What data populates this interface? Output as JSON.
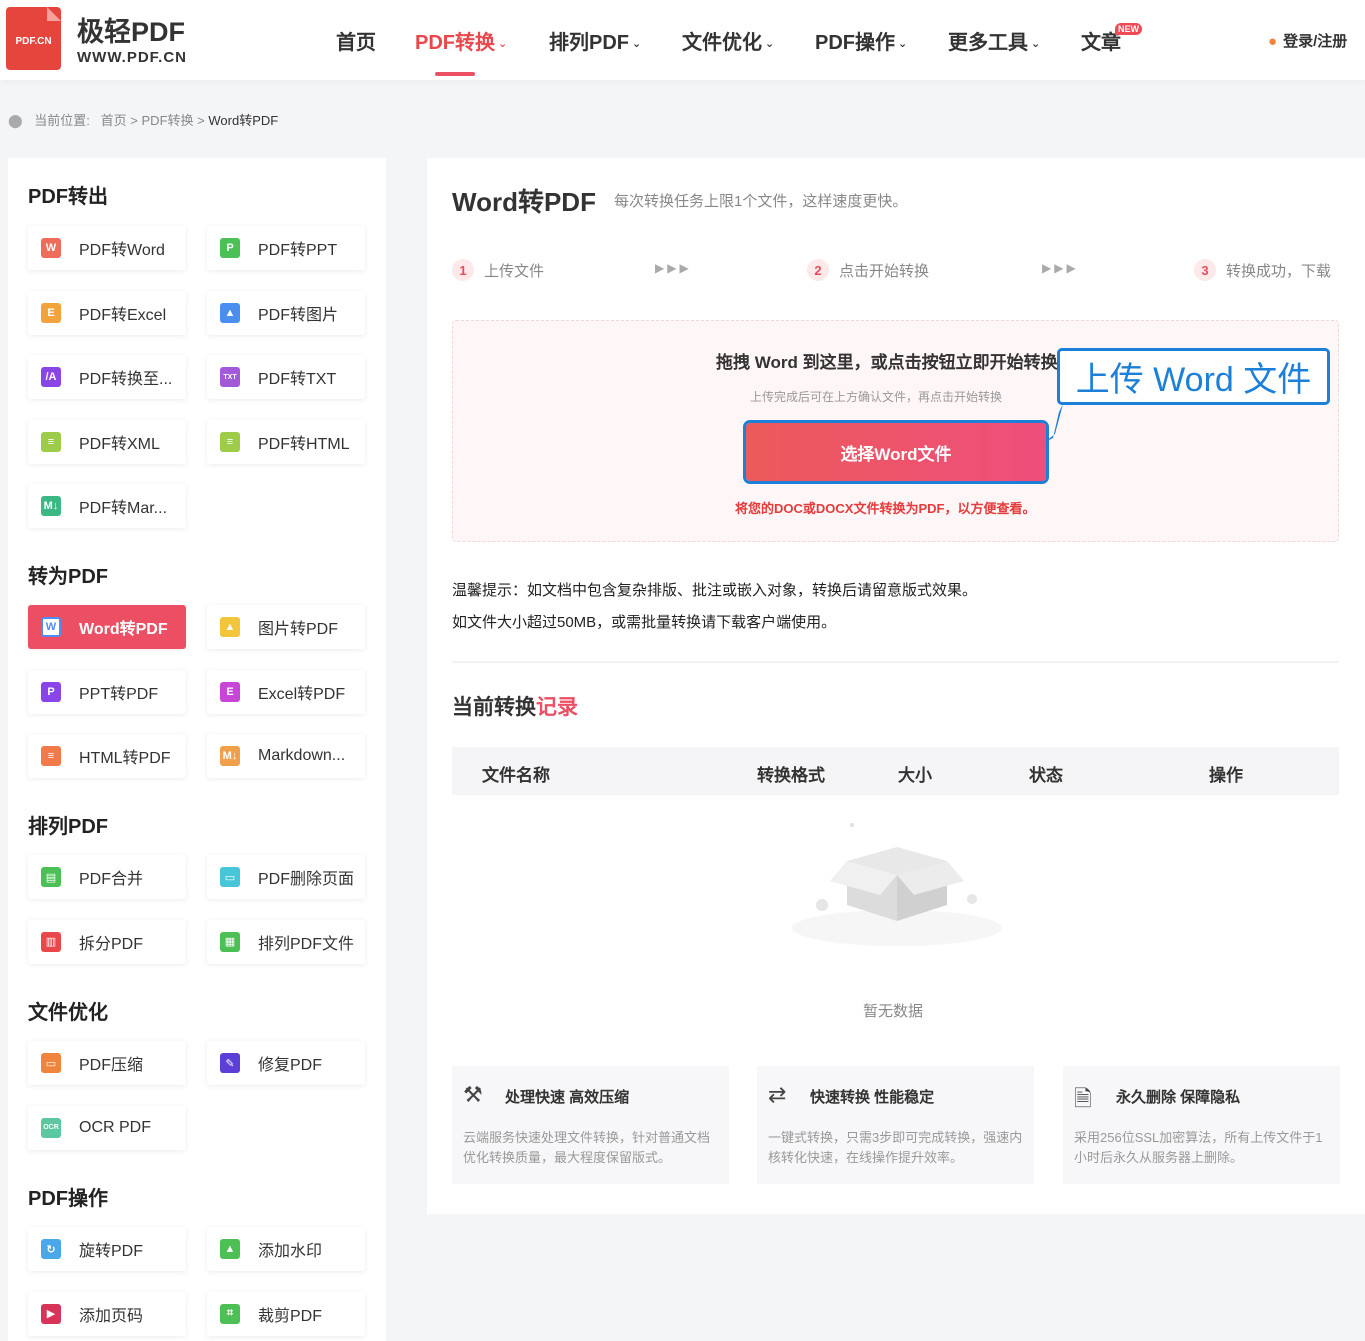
{
  "header": {
    "logo_text": "PDF.CN",
    "brand_name": "极轻PDF",
    "brand_url": "WWW.PDF.CN",
    "nav": [
      {
        "label": "首页",
        "chevron": false,
        "active": false
      },
      {
        "label": "PDF转换",
        "chevron": true,
        "active": true
      },
      {
        "label": "排列PDF",
        "chevron": true,
        "active": false
      },
      {
        "label": "文件优化",
        "chevron": true,
        "active": false
      },
      {
        "label": "PDF操作",
        "chevron": true,
        "active": false
      },
      {
        "label": "更多工具",
        "chevron": true,
        "active": false
      },
      {
        "label": "文章",
        "chevron": false,
        "active": false
      }
    ],
    "new_badge": "NEW",
    "login": "登录/注册"
  },
  "breadcrumb": {
    "prefix": "当前位置:",
    "home": "首页",
    "sep1": ">",
    "section": "PDF转换",
    "sep2": ">",
    "current": "Word转PDF"
  },
  "sidebar": {
    "sections": [
      {
        "title": "PDF转出",
        "items": [
          {
            "label": "PDF转Word",
            "icon": "word-icon",
            "glyph": "W",
            "color": "#ef6b5a"
          },
          {
            "label": "PDF转PPT",
            "icon": "ppt-icon",
            "glyph": "P",
            "color": "#4cbf55"
          },
          {
            "label": "PDF转Excel",
            "icon": "excel-icon",
            "glyph": "E",
            "color": "#f4a23b"
          },
          {
            "label": "PDF转图片",
            "icon": "image-icon",
            "glyph": "▲",
            "color": "#4a8ff0"
          },
          {
            "label": "PDF转换至...",
            "icon": "convert-icon",
            "glyph": "/A",
            "color": "#8a45e8"
          },
          {
            "label": "PDF转TXT",
            "icon": "txt-icon",
            "glyph": "TXT",
            "color": "#a35ad8"
          },
          {
            "label": "PDF转XML",
            "icon": "xml-icon",
            "glyph": "≡",
            "color": "#9ccc48"
          },
          {
            "label": "PDF转HTML",
            "icon": "html-icon",
            "glyph": "≡",
            "color": "#9ccc48"
          },
          {
            "label": "PDF转Mar...",
            "icon": "markdown-icon",
            "glyph": "M↓",
            "color": "#3bb884"
          }
        ]
      },
      {
        "title": "转为PDF",
        "items": [
          {
            "label": "Word转PDF",
            "icon": "word-icon",
            "glyph": "W",
            "color": "#4f8df5",
            "active": true
          },
          {
            "label": "图片转PDF",
            "icon": "image-icon",
            "glyph": "▲",
            "color": "#f2c53b"
          },
          {
            "label": "PPT转PDF",
            "icon": "ppt-icon",
            "glyph": "P",
            "color": "#8a45e8"
          },
          {
            "label": "Excel转PDF",
            "icon": "excel-icon",
            "glyph": "E",
            "color": "#c846d6"
          },
          {
            "label": "HTML转PDF",
            "icon": "html-icon",
            "glyph": "≡",
            "color": "#f07a4a"
          },
          {
            "label": "Markdown...",
            "icon": "markdown-icon",
            "glyph": "M↓",
            "color": "#f0a04a"
          }
        ]
      },
      {
        "title": "排列PDF",
        "items": [
          {
            "label": "PDF合并",
            "icon": "merge-icon",
            "glyph": "▤",
            "color": "#4cbf55"
          },
          {
            "label": "PDF删除页面",
            "icon": "delete-page-icon",
            "glyph": "▭",
            "color": "#46c6d8"
          },
          {
            "label": "拆分PDF",
            "icon": "split-icon",
            "glyph": "▥",
            "color": "#e8484c"
          },
          {
            "label": "排列PDF文件",
            "icon": "arrange-icon",
            "glyph": "▦",
            "color": "#4cbf55"
          }
        ]
      },
      {
        "title": "文件优化",
        "items": [
          {
            "label": "PDF压缩",
            "icon": "compress-icon",
            "glyph": "▭",
            "color": "#f0843c"
          },
          {
            "label": "修复PDF",
            "icon": "repair-icon",
            "glyph": "✎",
            "color": "#5b3fd6"
          },
          {
            "label": "OCR PDF",
            "icon": "ocr-icon",
            "glyph": "OCR",
            "color": "#5cc8a0"
          }
        ]
      },
      {
        "title": "PDF操作",
        "items": [
          {
            "label": "旋转PDF",
            "icon": "rotate-icon",
            "glyph": "↻",
            "color": "#4aa8e8"
          },
          {
            "label": "添加水印",
            "icon": "watermark-icon",
            "glyph": "▲",
            "color": "#4cbf55"
          },
          {
            "label": "添加页码",
            "icon": "page-number-icon",
            "glyph": "▶",
            "color": "#d8345a"
          },
          {
            "label": "裁剪PDF",
            "icon": "crop-icon",
            "glyph": "⌗",
            "color": "#4cbf55"
          }
        ]
      }
    ]
  },
  "main": {
    "title": "Word转PDF",
    "subtitle": "每次转换任务上限1个文件，这样速度更快。",
    "steps": [
      {
        "num": "1",
        "label": "上传文件"
      },
      {
        "num": "2",
        "label": "点击开始转换"
      },
      {
        "num": "3",
        "label": "转换成功，下载"
      }
    ],
    "step_arrows": "▶▶▶",
    "upload": {
      "title": "拖拽 Word 到这里，或点击按钮立即开始转换",
      "subtitle": "上传完成后可在上方确认文件，再点击开始转换",
      "button": "选择Word文件",
      "note": "将您的DOC或DOCX文件转换为PDF，以方便查看。"
    },
    "callout": "上传 Word 文件",
    "tips": [
      "温馨提示：如文档中包含复杂排版、批注或嵌入对象，转换后请留意版式效果。",
      "如文件大小超过50MB，或需批量转换请下载客户端使用。"
    ],
    "records": {
      "title_prefix": "当前转换",
      "title_highlight": "记录",
      "columns": [
        "文件名称",
        "转换格式",
        "大小",
        "状态",
        "操作"
      ],
      "empty": "暂无数据"
    },
    "features": [
      {
        "icon": "toolbox-icon",
        "glyph": "⚒",
        "title": "处理快速 高效压缩",
        "desc": "云端服务快速处理文件转换，针对普通文档优化转换质量，最大程度保留版式。"
      },
      {
        "icon": "sync-icon",
        "glyph": "⇄",
        "title": "快速转换 性能稳定",
        "desc": "一键式转换，只需3步即可完成转换，强速内核转化快速，在线操作提升效率。"
      },
      {
        "icon": "privacy-icon",
        "glyph": "🗎",
        "title": "永久删除 保障隐私",
        "desc": "采用256位SSL加密算法，所有上传文件于1小时后永久从服务器上删除。"
      }
    ]
  }
}
